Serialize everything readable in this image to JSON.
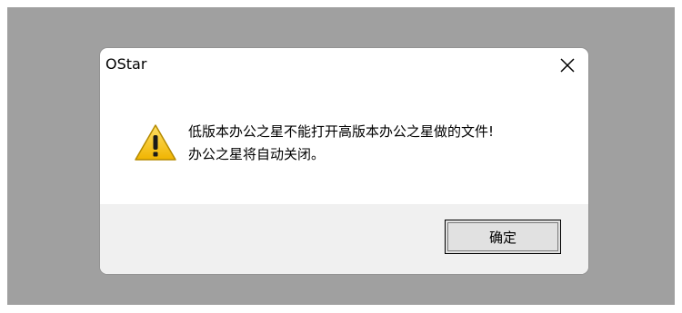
{
  "dialog": {
    "title": "OStar",
    "close_icon": "close-icon",
    "message_lines": [
      "低版本办公之星不能打开高版本办公之星做的文件!",
      "办公之星将自动关闭。"
    ],
    "icon": "warning-icon",
    "ok_label": "确定"
  },
  "colors": {
    "backdrop": "#a0a0a0",
    "dialog_bg": "#ffffff",
    "footer_bg": "#f0f0f0",
    "warning_fill": "#f5c400"
  }
}
